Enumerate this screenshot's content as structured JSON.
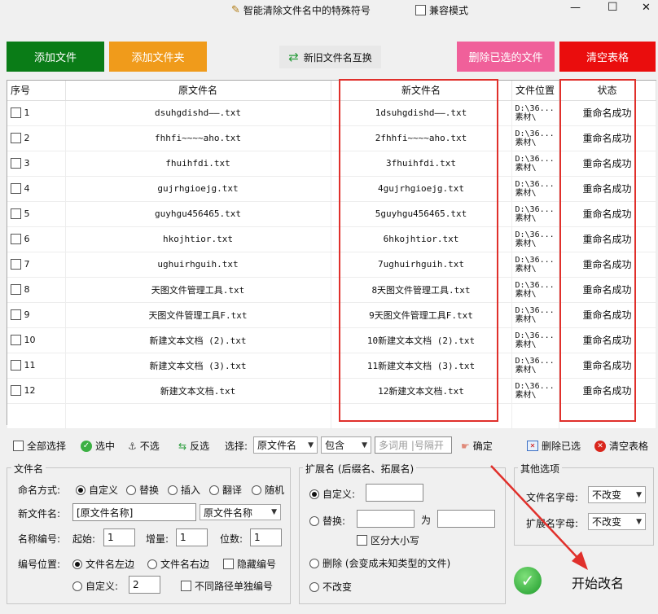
{
  "window": {
    "title": "智能清除文件名中的特殊符号",
    "compat_mode": "兼容模式",
    "minimize": "—",
    "maximize": "☐",
    "close": "✕"
  },
  "toolbar": {
    "add_file": "添加文件",
    "add_folder": "添加文件夹",
    "swap_names": "新旧文件名互换",
    "delete_selected": "删除已选的文件",
    "clear_table": "清空表格"
  },
  "table": {
    "headers": [
      "序号",
      "原文件名",
      "新文件名",
      "文件位置",
      "状态"
    ],
    "rows": [
      {
        "idx": "1",
        "orig": "dsuhgdishd——.txt",
        "new": "1dsuhgdishd——.txt",
        "loc1": "D:\\36...",
        "loc2": "素材\\",
        "status": "重命名成功"
      },
      {
        "idx": "2",
        "orig": "fhhfi~~~~aho.txt",
        "new": "2fhhfi~~~~aho.txt",
        "loc1": "D:\\36...",
        "loc2": "素材\\",
        "status": "重命名成功"
      },
      {
        "idx": "3",
        "orig": "fhuihfdi.txt",
        "new": "3fhuihfdi.txt",
        "loc1": "D:\\36...",
        "loc2": "素材\\",
        "status": "重命名成功"
      },
      {
        "idx": "4",
        "orig": "gujrhgioejg.txt",
        "new": "4gujrhgioejg.txt",
        "loc1": "D:\\36...",
        "loc2": "素材\\",
        "status": "重命名成功"
      },
      {
        "idx": "5",
        "orig": "guyhgu456465.txt",
        "new": "5guyhgu456465.txt",
        "loc1": "D:\\36...",
        "loc2": "素材\\",
        "status": "重命名成功"
      },
      {
        "idx": "6",
        "orig": "hkojhtior.txt",
        "new": "6hkojhtior.txt",
        "loc1": "D:\\36...",
        "loc2": "素材\\",
        "status": "重命名成功"
      },
      {
        "idx": "7",
        "orig": "ughuirhguih.txt",
        "new": "7ughuirhguih.txt",
        "loc1": "D:\\36...",
        "loc2": "素材\\",
        "status": "重命名成功"
      },
      {
        "idx": "8",
        "orig": "天图文件管理工具.txt",
        "new": "8天图文件管理工具.txt",
        "loc1": "D:\\36...",
        "loc2": "素材\\",
        "status": "重命名成功"
      },
      {
        "idx": "9",
        "orig": "天图文件管理工具F.txt",
        "new": "9天图文件管理工具F.txt",
        "loc1": "D:\\36...",
        "loc2": "素材\\",
        "status": "重命名成功"
      },
      {
        "idx": "10",
        "orig": "新建文本文档 (2).txt",
        "new": "10新建文本文档 (2).txt",
        "loc1": "D:\\36...",
        "loc2": "素材\\",
        "status": "重命名成功"
      },
      {
        "idx": "11",
        "orig": "新建文本文档 (3).txt",
        "new": "11新建文本文档 (3).txt",
        "loc1": "D:\\36...",
        "loc2": "素材\\",
        "status": "重命名成功"
      },
      {
        "idx": "12",
        "orig": "新建文本文档.txt",
        "new": "12新建文本文档.txt",
        "loc1": "D:\\36...",
        "loc2": "素材\\",
        "status": "重命名成功"
      }
    ]
  },
  "selection_bar": {
    "select_all": "全部选择",
    "select": "选中",
    "unselect": "不选",
    "invert": "反选",
    "choose_label": "选择:",
    "field_select": "原文件名",
    "match_select": "包含",
    "keyword_placeholder": "多词用 |号隔开",
    "confirm": "确定",
    "delete_selected": "删除已选",
    "clear_table": "清空表格"
  },
  "filename_panel": {
    "title": "文件名",
    "naming_mode_label": "命名方式:",
    "modes": [
      "自定义",
      "替换",
      "插入",
      "翻译",
      "随机"
    ],
    "new_name_label": "新文件名:",
    "new_name_value": "[原文件名称]",
    "new_name_select": "原文件名称",
    "numbering_label": "名称编号:",
    "start_label": "起始:",
    "start_value": "1",
    "step_label": "增量:",
    "step_value": "1",
    "digits_label": "位数:",
    "digits_value": "1",
    "position_label": "编号位置:",
    "pos_left": "文件名左边",
    "pos_right": "文件名右边",
    "hide_number": "隐藏编号",
    "custom_label": "自定义:",
    "custom_value": "2",
    "per_path": "不同路径单独编号"
  },
  "ext_panel": {
    "title": "扩展名 (后缀名、拓展名)",
    "custom_label": "自定义:",
    "replace_label": "替换:",
    "to_label": "为",
    "case_sensitive": "区分大小写",
    "delete_label": "删除 (会变成未知类型的文件)",
    "no_change": "不改变"
  },
  "other_panel": {
    "title": "其他选项",
    "name_case_label": "文件名字母:",
    "name_case_value": "不改变",
    "ext_case_label": "扩展名字母:",
    "ext_case_value": "不改变"
  },
  "start_button": "开始改名",
  "colors": {
    "add_file": "#0a7c17",
    "add_folder": "#f09b1b",
    "delete_selected": "#f0609a",
    "clear_table": "#ea0d0d",
    "annotation": "#e0302b"
  }
}
